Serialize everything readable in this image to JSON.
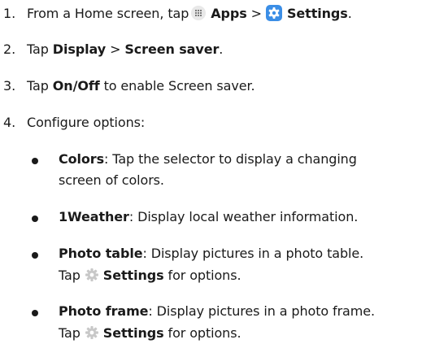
{
  "steps": [
    {
      "number": "1.",
      "prefix": "From a Home screen, tap",
      "apps_label": "Apps",
      "separator": ">",
      "settings_label": "Settings",
      "suffix": "."
    },
    {
      "number": "2.",
      "prefix": "Tap",
      "display_label": "Display",
      "separator": ">",
      "screensaver_label": "Screen saver",
      "suffix": "."
    },
    {
      "number": "3.",
      "prefix": "Tap",
      "onoff_label": "On/Off",
      "suffix": "to enable Screen saver."
    },
    {
      "number": "4.",
      "text": "Configure options:"
    }
  ],
  "options": [
    {
      "name": "Colors",
      "line1_a": ": Tap the selector",
      "line1_b": "to display a changing",
      "line2": "screen of colors."
    },
    {
      "name": "1Weather",
      "line1_a": ": Display local weather information."
    },
    {
      "name": "Photo table",
      "line1_a": ": Display pictures in a photo table.",
      "line2_prefix": "Tap",
      "line2_settings": "Settings",
      "line2_suffix": "for options."
    },
    {
      "name": "Photo frame",
      "line1_a": ": Display pictures in a photo frame.",
      "line2_prefix": "Tap",
      "line2_settings": "Settings",
      "line2_suffix": "for options."
    }
  ],
  "colors": {
    "text": "#1a1a1a",
    "settings_icon_bg": "#3b8ee6",
    "gear_color": "#c8c8c8"
  },
  "icons": [
    "apps-icon",
    "settings-app-icon",
    "gear-icon"
  ]
}
